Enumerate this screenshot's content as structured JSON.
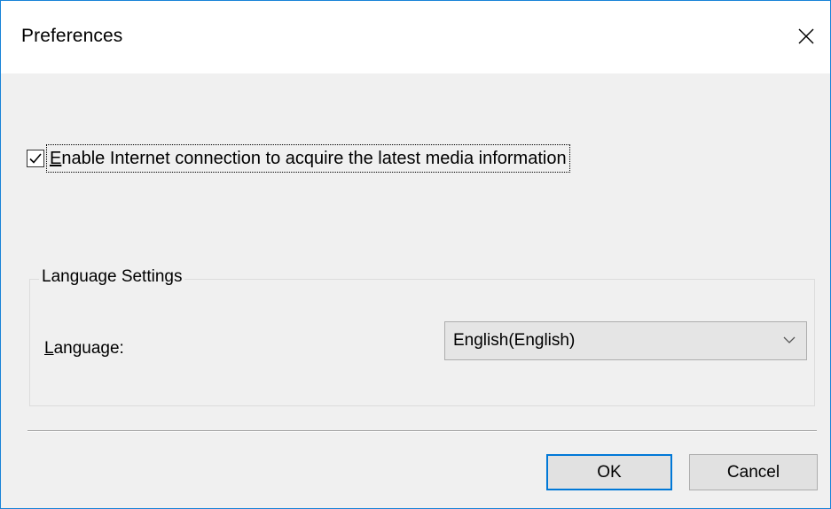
{
  "window": {
    "title": "Preferences"
  },
  "internet": {
    "checked": true,
    "label": "Enable Internet connection to acquire the latest media information",
    "mnemonic": "E"
  },
  "language_group": {
    "legend": "Language Settings",
    "label": "Language:",
    "label_mnemonic": "L",
    "selected_value": "English(English)"
  },
  "buttons": {
    "ok": "OK",
    "cancel": "Cancel"
  },
  "icons": {
    "close": "close-icon",
    "check": "checkmark-icon",
    "dropdown": "chevron-down-icon"
  },
  "colors": {
    "window_border": "#1883d7",
    "dialog_bg": "#f0f0f0",
    "default_button_border": "#0078d7"
  }
}
